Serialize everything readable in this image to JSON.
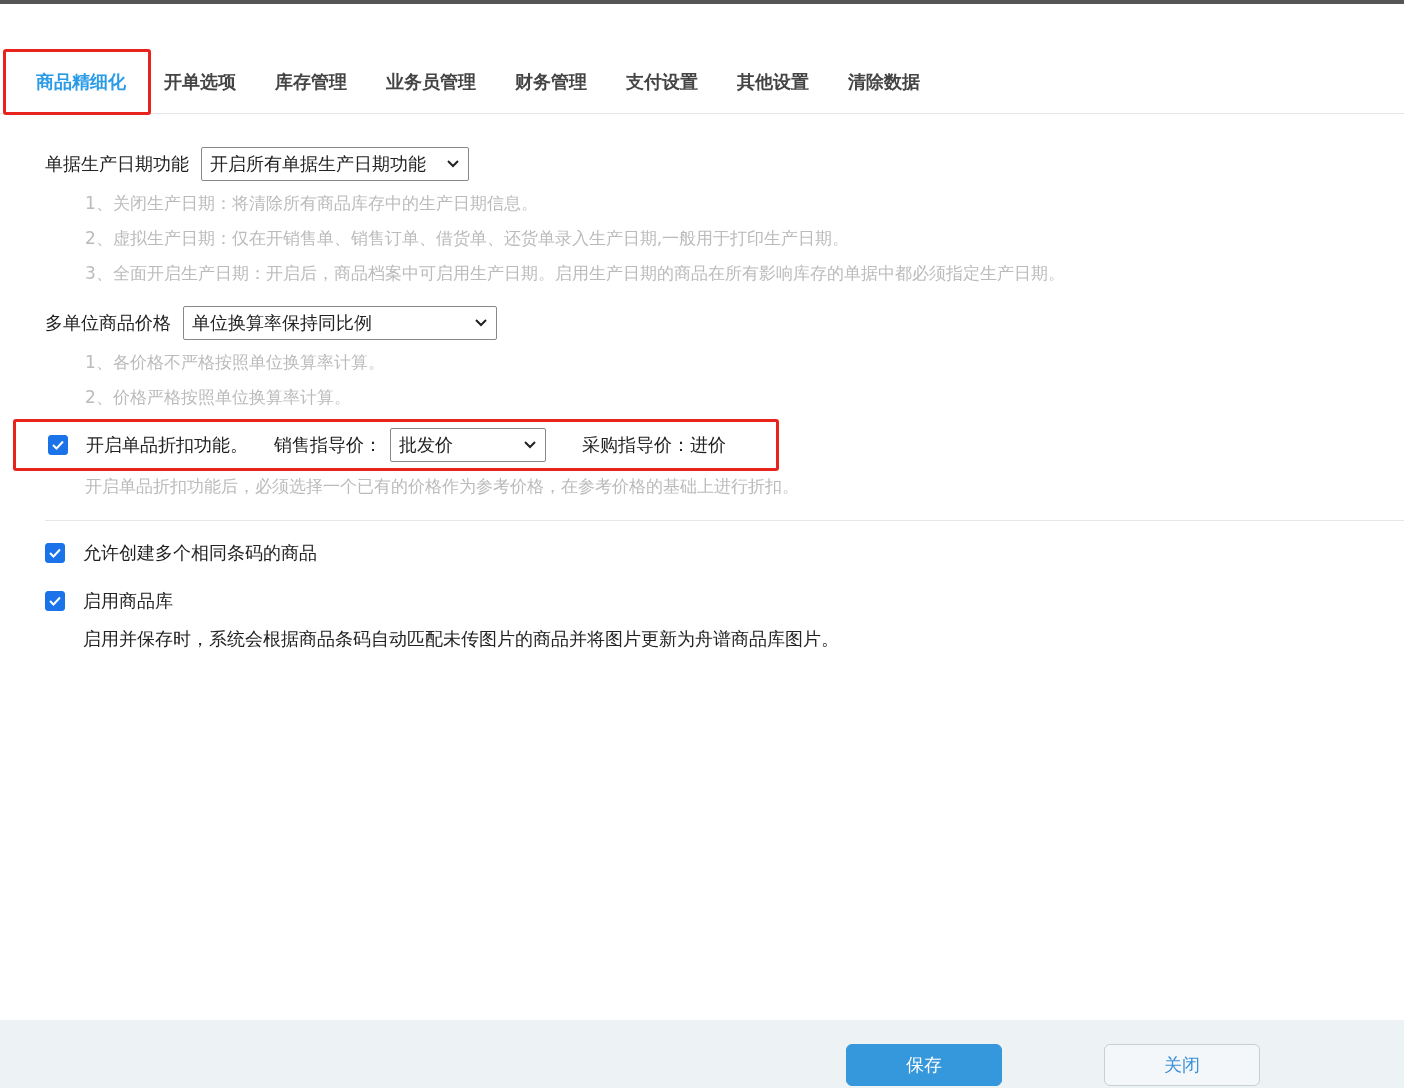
{
  "tabs": [
    {
      "label": "商品精细化",
      "selected": true,
      "highlighted": true
    },
    {
      "label": "开单选项",
      "selected": false,
      "highlighted": false
    },
    {
      "label": "库存管理",
      "selected": false,
      "highlighted": false
    },
    {
      "label": "业务员管理",
      "selected": false,
      "highlighted": false
    },
    {
      "label": "财务管理",
      "selected": false,
      "highlighted": false
    },
    {
      "label": "支付设置",
      "selected": false,
      "highlighted": false
    },
    {
      "label": "其他设置",
      "selected": false,
      "highlighted": false
    },
    {
      "label": "清除数据",
      "selected": false,
      "highlighted": false
    }
  ],
  "production_date": {
    "label": "单据生产日期功能",
    "value": "开启所有单据生产日期功能",
    "notes": [
      "1、关闭生产日期：将清除所有商品库存中的生产日期信息。",
      "2、虚拟生产日期：仅在开销售单、销售订单、借货单、还货单录入生产日期,一般用于打印生产日期。",
      "3、全面开启生产日期：开启后，商品档案中可启用生产日期。启用生产日期的商品在所有影响库存的单据中都必须指定生产日期。"
    ]
  },
  "multi_unit_price": {
    "label": "多单位商品价格",
    "value": "单位换算率保持同比例",
    "notes": [
      "1、各价格不严格按照单位换算率计算。",
      "2、价格严格按照单位换算率计算。"
    ]
  },
  "discount": {
    "highlighted": true,
    "checked": true,
    "label": "开启单品折扣功能。",
    "sale_guide_label": "销售指导价：",
    "sale_guide_value": "批发价",
    "purchase_guide": "采购指导价：进价",
    "note": "开启单品折扣功能后，必须选择一个已有的价格作为参考价格，在参考价格的基础上进行折扣。"
  },
  "options": [
    {
      "checked": true,
      "label": "允许创建多个相同条码的商品"
    },
    {
      "checked": true,
      "label": "启用商品库",
      "note": "启用并保存时，系统会根据商品条码自动匹配未传图片的商品并将图片更新为舟谱商品库图片。"
    }
  ],
  "buttons": [
    {
      "kind": "primary",
      "label": "保存"
    },
    {
      "kind": "secondary",
      "label": "关闭"
    }
  ]
}
